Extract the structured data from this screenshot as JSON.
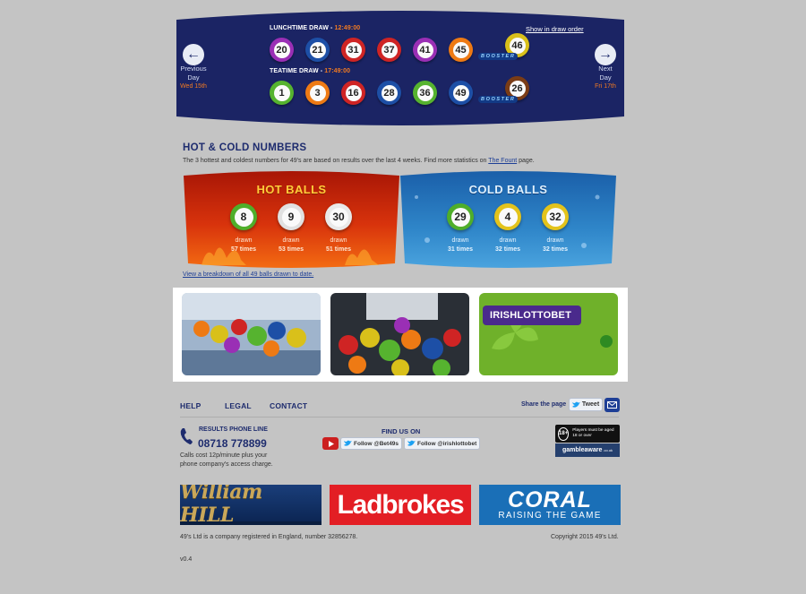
{
  "draws": {
    "show_order_label": "Show in draw order",
    "booster_label": "BOOSTER",
    "lunchtime": {
      "title": "LUNCHTIME DRAW -",
      "time": "12:49:00",
      "balls": [
        20,
        21,
        31,
        37,
        41,
        45
      ],
      "booster": 46
    },
    "teatime": {
      "title": "TEATIME DRAW -",
      "time": "17:49:00",
      "balls": [
        1,
        3,
        16,
        28,
        36,
        49
      ],
      "booster": 26
    }
  },
  "nav": {
    "prev_line1": "Previous",
    "prev_line2": "Day",
    "prev_date": "Wed 15th",
    "next_line1": "Next",
    "next_line2": "Day",
    "next_date": "Fri 17th"
  },
  "hot_cold": {
    "title": "HOT & COLD NUMBERS",
    "desc_prefix": "The 3 hottest and coldest numbers for 49's are based on results over the last 4 weeks. Find more statistics on ",
    "desc_link": "The Fount",
    "desc_suffix": " page.",
    "hot": {
      "title": "HOT BALLS",
      "balls": [
        {
          "number": "8",
          "drawn_label": "drawn",
          "times": "57 times",
          "color": "#4fae2a"
        },
        {
          "number": "9",
          "drawn_label": "drawn",
          "times": "53 times",
          "color": "#e1e1e1"
        },
        {
          "number": "30",
          "drawn_label": "drawn",
          "times": "51 times",
          "color": "#e9e9e9"
        }
      ]
    },
    "cold": {
      "title": "COLD BALLS",
      "balls": [
        {
          "number": "29",
          "drawn_label": "drawn",
          "times": "31 times",
          "color": "#4fae2a"
        },
        {
          "number": "4",
          "drawn_label": "drawn",
          "times": "32 times",
          "color": "#e3c31b"
        },
        {
          "number": "32",
          "drawn_label": "drawn",
          "times": "32 times",
          "color": "#e3c31b"
        }
      ]
    },
    "breakdown_link": "View a breakdown of all 49 balls drawn to date."
  },
  "promos": {
    "irish_logo_text": "IRISHLOTTOBET"
  },
  "footer": {
    "links": [
      "HELP",
      "LEGAL",
      "CONTACT"
    ],
    "share_label": "Share the page",
    "tweet_label": "Tweet",
    "phone_label": "RESULTS PHONE LINE",
    "phone_number": "08718 778899",
    "phone_note": "Calls cost 12p/minute plus your phone company's access charge.",
    "find_us": "FIND US ON",
    "follow_1": "Follow @Bet49s",
    "follow_2": "Follow @irishlottobet",
    "age_mark": "18+",
    "age_text": "Players must be aged 18 or over",
    "gamble_text": "gambleaware",
    "gamble_suffix": ".co.uk",
    "bookies": [
      "William HILL",
      "Ladbrokes",
      "CORAL",
      "RAISING THE GAME"
    ],
    "legal_note": "49's Ltd is a company registered in England, number 32856278.",
    "copyright": "Copyright 2015 49's Ltd.",
    "version": "v0.4"
  },
  "colors": {
    "banner_bg": "#1b2464",
    "accent_orange": "#f07a22",
    "hot_bg": "#e0350e",
    "cold_bg": "#2f86c9",
    "ball_colors": {
      "purple": "#9a2fb5",
      "blue": "#1d4fa6",
      "red": "#cf2424",
      "orange": "#ee7a14",
      "green": "#56b32f",
      "yellow": "#d9c01a",
      "brown": "#7a3c16"
    }
  }
}
